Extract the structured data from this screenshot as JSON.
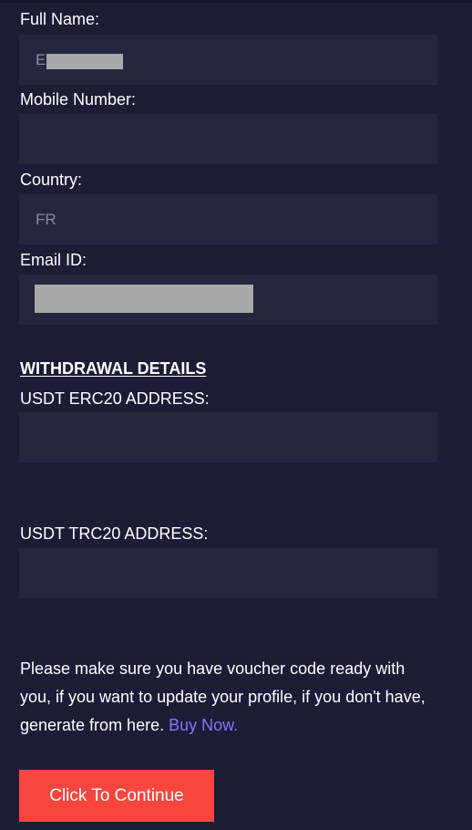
{
  "form": {
    "full_name": {
      "label": "Full Name:",
      "value": "E"
    },
    "mobile_number": {
      "label": "Mobile Number:",
      "value": ""
    },
    "country": {
      "label": "Country:",
      "value": "FR"
    },
    "email": {
      "label": "Email ID:",
      "value": ""
    }
  },
  "withdrawal": {
    "heading": "WITHDRAWAL DETAILS",
    "erc20": {
      "label": "USDT ERC20 ADDRESS:",
      "value": ""
    },
    "trc20": {
      "label": "USDT TRC20 ADDRESS:",
      "value": ""
    }
  },
  "notice": {
    "text": "Please make sure you have voucher code ready with you, if you want to update your profile, if you don't have, generate from here. ",
    "link_label": "Buy Now."
  },
  "continue_button": {
    "label": "Click To Continue",
    "color": "#f8463f"
  },
  "colors": {
    "background": "#1b1c36",
    "field": "#25263f",
    "link": "#8a73ff"
  }
}
